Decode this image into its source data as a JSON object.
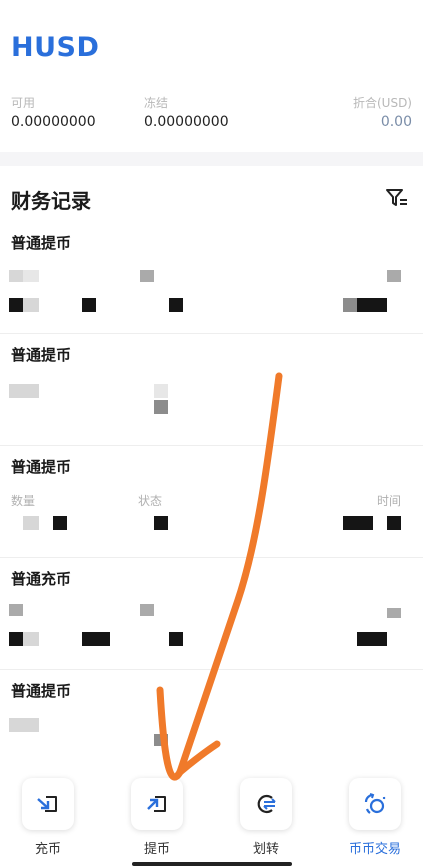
{
  "coin": {
    "symbol": "HUSD"
  },
  "balance": {
    "available_label": "可用",
    "available_value": "0.00000000",
    "frozen_label": "冻结",
    "frozen_value": "0.00000000",
    "converted_label": "折合(USD)",
    "converted_value": "0.00"
  },
  "records": {
    "title": "财务记录",
    "items": [
      {
        "type": "普通提币"
      },
      {
        "type": "普通提币"
      },
      {
        "type": "普通提币",
        "label_amount": "数量",
        "label_status": "状态",
        "label_time": "时间"
      },
      {
        "type": "普通充币"
      },
      {
        "type": "普通提币"
      }
    ]
  },
  "dock": {
    "deposit": "充币",
    "withdraw": "提币",
    "transfer": "划转",
    "trade": "币币交易"
  },
  "colors": {
    "accent": "#2a6fdb",
    "annotation": "#f07a2a"
  }
}
